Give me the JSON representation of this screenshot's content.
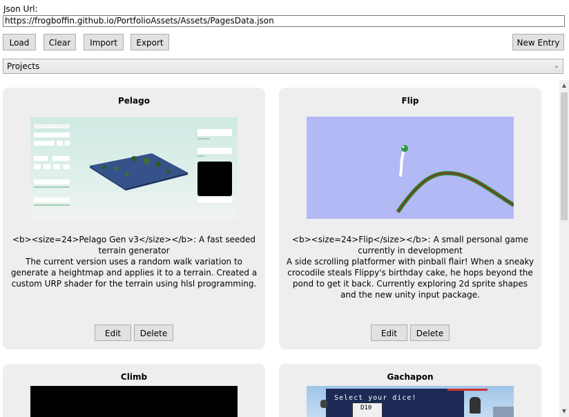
{
  "json_url": {
    "label": "Json Url:",
    "value": "https://frogboffin.github.io/PortfolioAssets/Assets/PagesData.json"
  },
  "toolbar": {
    "load": "Load",
    "clear": "Clear",
    "import": "Import",
    "export": "Export",
    "new_entry": "New Entry"
  },
  "category_select": {
    "selected": "Projects"
  },
  "cards": [
    {
      "title": "Pelago",
      "description": [
        "<b><size=24>Pelago Gen v3</size></b>: A fast seeded terrain generator",
        "The current version uses a random walk variation to generate a heightmap and applies it to a terrain.  Created a custom URP shader for the terrain using hlsl programming."
      ],
      "edit": "Edit",
      "delete": "Delete"
    },
    {
      "title": "Flip",
      "description": [
        "<b><size=24>Flip</size></b>: A small personal game currently in development",
        "A side scrolling platformer with pinball flair! When a sneaky crocodile steals Flippy's birthday cake, he hops beyond the pond to get it back. Currently exploring 2d sprite shapes and the new unity input package."
      ],
      "edit": "Edit",
      "delete": "Delete"
    },
    {
      "title": "Climb"
    },
    {
      "title": "Gachapon",
      "thumb_text": {
        "select": "Select your dice!",
        "d10": "D10"
      }
    }
  ],
  "colors": {
    "card_bg": "#eeeeee",
    "button_bg": "#e1e1e1",
    "flip_sky": "#b3b9f5",
    "flip_track": "#2a8a2a"
  }
}
